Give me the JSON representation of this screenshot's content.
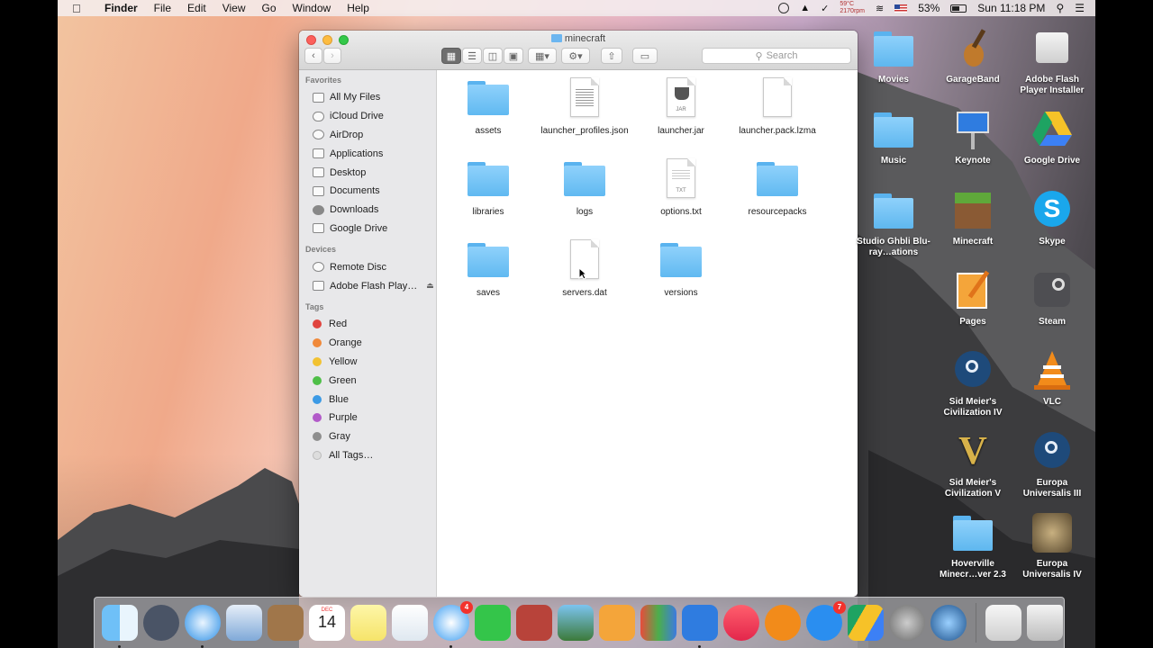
{
  "menubar": {
    "app_name": "Finder",
    "menus": [
      "File",
      "Edit",
      "View",
      "Go",
      "Window",
      "Help"
    ],
    "temperature": "59°C",
    "fan": "2170rpm",
    "battery": "53%",
    "clock": "Sun 11:18 PM"
  },
  "window": {
    "title": "minecraft",
    "search_placeholder": "Search"
  },
  "sidebar": {
    "favorites_header": "Favorites",
    "favorites": [
      "All My Files",
      "iCloud Drive",
      "AirDrop",
      "Applications",
      "Desktop",
      "Documents",
      "Downloads",
      "Google Drive"
    ],
    "devices_header": "Devices",
    "devices": [
      "Remote Disc",
      "Adobe Flash Play…"
    ],
    "tags_header": "Tags",
    "tags": [
      {
        "label": "Red",
        "color": "#e0443e"
      },
      {
        "label": "Orange",
        "color": "#f0893a"
      },
      {
        "label": "Yellow",
        "color": "#f2c232"
      },
      {
        "label": "Green",
        "color": "#4fbf48"
      },
      {
        "label": "Blue",
        "color": "#3c9ae5"
      },
      {
        "label": "Purple",
        "color": "#b25ac9"
      },
      {
        "label": "Gray",
        "color": "#8e8e8e"
      }
    ],
    "all_tags": "All Tags…"
  },
  "files": [
    {
      "name": "assets",
      "kind": "folder"
    },
    {
      "name": "launcher_profiles.json",
      "kind": "doc"
    },
    {
      "name": "launcher.jar",
      "kind": "jar",
      "badge": "JAR"
    },
    {
      "name": "launcher.pack.lzma",
      "kind": "blank"
    },
    {
      "name": "libraries",
      "kind": "folder"
    },
    {
      "name": "logs",
      "kind": "folder"
    },
    {
      "name": "options.txt",
      "kind": "txt",
      "badge": "TXT"
    },
    {
      "name": "resourcepacks",
      "kind": "folder"
    },
    {
      "name": "saves",
      "kind": "folder"
    },
    {
      "name": "servers.dat",
      "kind": "blank"
    },
    {
      "name": "versions",
      "kind": "folder"
    }
  ],
  "desktop": [
    {
      "name": "Movies"
    },
    {
      "name": "GarageBand"
    },
    {
      "name": "Adobe Flash Player Installer"
    },
    {
      "name": "Music"
    },
    {
      "name": "Keynote"
    },
    {
      "name": "Google Drive"
    },
    {
      "name": "Studio Ghbli Blu-ray…ations"
    },
    {
      "name": "Minecraft"
    },
    {
      "name": "Skype"
    },
    {
      "name": "Pages"
    },
    {
      "name": "Steam"
    },
    {
      "name": "Sid Meier's Civilization IV"
    },
    {
      "name": "VLC"
    },
    {
      "name": "Sid Meier's Civilization V"
    },
    {
      "name": "Europa Universalis III"
    },
    {
      "name": "Hoverville Minecr…ver 2.3"
    },
    {
      "name": "Europa Universalis IV"
    }
  ],
  "dock": {
    "calendar_month": "DEC",
    "calendar_day": "14",
    "messages_badge": "4",
    "appstore_badge": "7"
  }
}
